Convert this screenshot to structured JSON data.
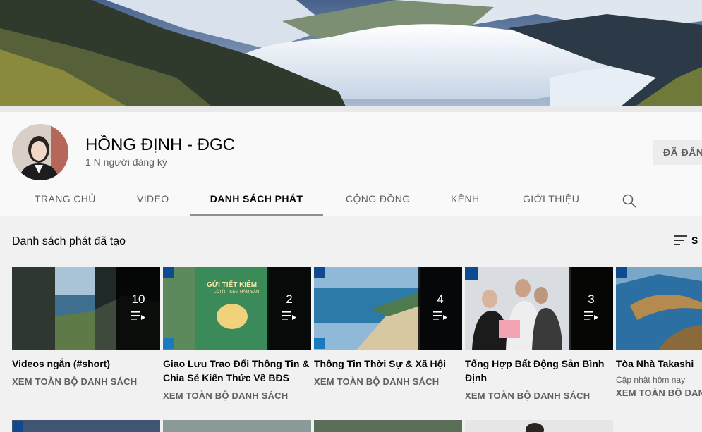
{
  "channel": {
    "name": "HỒNG ĐỊNH - ĐGC",
    "subscribers": "1 N người đăng ký",
    "subscribe_label": "ĐÃ ĐĂNG"
  },
  "tabs": [
    {
      "label": "TRANG CHỦ"
    },
    {
      "label": "VIDEO"
    },
    {
      "label": "DANH SÁCH PHÁT",
      "active": true
    },
    {
      "label": "CỘNG ĐỒNG"
    },
    {
      "label": "KÊNH"
    },
    {
      "label": "GIỚI THIỆU"
    }
  ],
  "section": {
    "title": "Danh sách phát đã tạo",
    "sort_label": "S"
  },
  "playlists": [
    {
      "title": "Videos ngắn (#short)",
      "count": "10",
      "link": "XEM TOÀN BỘ DANH SÁCH"
    },
    {
      "title": "Giao Lưu Trao Đổi Thông Tin & Chia Sẻ Kiến Thức Về BĐS",
      "count": "2",
      "link": "XEM TOÀN BỘ DANH SÁCH",
      "thumb_text": "GỬI TIẾT KIỆM",
      "thumb_subtext": "LỜI ÍT - KÈM HẦM SẢN"
    },
    {
      "title": "Thông Tin Thời Sự & Xã Hội",
      "count": "4",
      "link": "XEM TOÀN BỘ DANH SÁCH"
    },
    {
      "title": "Tổng Hợp Bất Động Sản Bình Định",
      "count": "3",
      "link": "XEM TOÀN BỘ DANH SÁCH"
    },
    {
      "title": "Tòa Nhà Takashi",
      "updated": "Cập nhật hôm nay",
      "link": "XEM TOÀN BỘ DANH"
    }
  ],
  "colors": {
    "header_bg": "#f9f9f9",
    "content_bg": "#f1f1f1",
    "text_primary": "#030303",
    "text_secondary": "#606060",
    "tab_underline": "#909090"
  },
  "icons": {
    "search": "search-icon",
    "sort": "sort-icon",
    "playlist": "playlist-play-icon"
  }
}
